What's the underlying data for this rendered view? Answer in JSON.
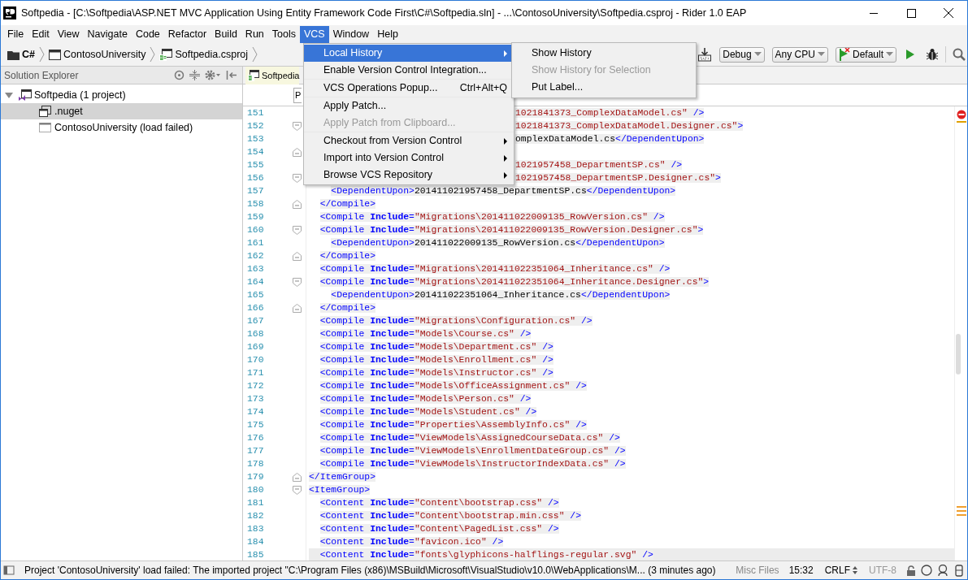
{
  "window": {
    "title": "Softpedia - [C:\\Softpedia\\ASP.NET MVC Application Using Entity Framework Code First\\C#\\Softpedia.sln] - ...\\ContosoUniversity\\Softpedia.csproj - Rider 1.0 EAP"
  },
  "menubar": [
    {
      "label": "File",
      "selected": false
    },
    {
      "label": "Edit",
      "selected": false
    },
    {
      "label": "View",
      "selected": false
    },
    {
      "label": "Navigate",
      "selected": false
    },
    {
      "label": "Code",
      "selected": false
    },
    {
      "label": "Refactor",
      "selected": false
    },
    {
      "label": "Build",
      "selected": false
    },
    {
      "label": "Run",
      "selected": false
    },
    {
      "label": "Tools",
      "selected": false
    },
    {
      "label": "VCS",
      "selected": true
    },
    {
      "label": "Window",
      "selected": false
    },
    {
      "label": "Help",
      "selected": false
    }
  ],
  "breadcrumbs": [
    {
      "label": "C#",
      "kind": "folder"
    },
    {
      "label": "ContosoUniversity",
      "kind": "project"
    },
    {
      "label": "Softpedia.csproj",
      "kind": "csproj"
    }
  ],
  "toolbar": {
    "configurations": [
      "Debug",
      "Any CPU",
      "Default"
    ]
  },
  "solution_explorer": {
    "title": "Solution Explorer",
    "tree": [
      {
        "label": "Softpedia (1 project)",
        "kind": "solution",
        "expanded": true,
        "selected": false,
        "children": [
          {
            "label": ".nuget",
            "kind": "folder",
            "selected": true
          },
          {
            "label": "ContosoUniversity (load failed)",
            "kind": "failed",
            "selected": false
          }
        ]
      }
    ]
  },
  "editor": {
    "tab": "Softpedia",
    "structure_field": "P",
    "lines": [
      {
        "number": "151",
        "covered": true,
        "starts_in_string": true,
        "text": "1021841373_ComplexDataModel.cs\" />"
      },
      {
        "number": "152",
        "covered": true,
        "starts_in_string": true,
        "text": "1021841373_ComplexDataModel.Designer.cs\">",
        "fold_open": true
      },
      {
        "number": "153",
        "covered": true,
        "starts_in_string": false,
        "text": "omplexDataModel.cs</DependentUpon>"
      },
      {
        "number": "154",
        "fold_open": false
      },
      {
        "number": "155",
        "covered": true,
        "starts_in_string": true,
        "text": "1021957458_DepartmentSP.cs\" />"
      },
      {
        "number": "156",
        "covered": true,
        "starts_in_string": true,
        "text": "1021957458_DepartmentSP.Designer.cs\">",
        "fold_open": true
      },
      {
        "number": "157",
        "text": "    <DependentUpon>201411021957458_DepartmentSP.cs</DependentUpon>"
      },
      {
        "number": "158",
        "text": "  </Compile>",
        "fold_open": false
      },
      {
        "number": "159",
        "text": "  <Compile Include=\"Migrations\\201411022009135_RowVersion.cs\" />"
      },
      {
        "number": "160",
        "text": "  <Compile Include=\"Migrations\\201411022009135_RowVersion.Designer.cs\">",
        "fold_open": true
      },
      {
        "number": "161",
        "text": "    <DependentUpon>201411022009135_RowVersion.cs</DependentUpon>"
      },
      {
        "number": "162",
        "text": "  </Compile>",
        "fold_open": false
      },
      {
        "number": "163",
        "text": "  <Compile Include=\"Migrations\\201411022351064_Inheritance.cs\" />"
      },
      {
        "number": "164",
        "text": "  <Compile Include=\"Migrations\\201411022351064_Inheritance.Designer.cs\">",
        "fold_open": true
      },
      {
        "number": "165",
        "text": "    <DependentUpon>201411022351064_Inheritance.cs</DependentUpon>"
      },
      {
        "number": "166",
        "text": "  </Compile>",
        "fold_open": false
      },
      {
        "number": "167",
        "text": "  <Compile Include=\"Migrations\\Configuration.cs\" />"
      },
      {
        "number": "168",
        "text": "  <Compile Include=\"Models\\Course.cs\" />"
      },
      {
        "number": "169",
        "text": "  <Compile Include=\"Models\\Department.cs\" />"
      },
      {
        "number": "170",
        "text": "  <Compile Include=\"Models\\Enrollment.cs\" />"
      },
      {
        "number": "171",
        "text": "  <Compile Include=\"Models\\Instructor.cs\" />"
      },
      {
        "number": "172",
        "text": "  <Compile Include=\"Models\\OfficeAssignment.cs\" />"
      },
      {
        "number": "173",
        "text": "  <Compile Include=\"Models\\Person.cs\" />"
      },
      {
        "number": "174",
        "text": "  <Compile Include=\"Models\\Student.cs\" />"
      },
      {
        "number": "175",
        "text": "  <Compile Include=\"Properties\\AssemblyInfo.cs\" />"
      },
      {
        "number": "176",
        "text": "  <Compile Include=\"ViewModels\\AssignedCourseData.cs\" />"
      },
      {
        "number": "177",
        "text": "  <Compile Include=\"ViewModels\\EnrollmentDateGroup.cs\" />"
      },
      {
        "number": "178",
        "text": "  <Compile Include=\"ViewModels\\InstructorIndexData.cs\" />"
      },
      {
        "number": "179",
        "text": "</ItemGroup>",
        "fold_open": false
      },
      {
        "number": "180",
        "text": "<ItemGroup>",
        "fold_open": true
      },
      {
        "number": "181",
        "text": "  <Content Include=\"Content\\bootstrap.css\" />"
      },
      {
        "number": "182",
        "text": "  <Content Include=\"Content\\bootstrap.min.css\" />"
      },
      {
        "number": "183",
        "text": "  <Content Include=\"Content\\PagedList.css\" />"
      },
      {
        "number": "184",
        "text": "  <Content Include=\"favicon.ico\" />"
      },
      {
        "number": "185",
        "text": "  <Content Include=\"fonts\\glyphicons-halflings-regular.svg\" />",
        "current": true
      }
    ]
  },
  "vcs_menu": [
    {
      "kind": "item",
      "label": "Local History",
      "submenu": true,
      "selected": true,
      "disabled": false
    },
    {
      "kind": "item",
      "label": "Enable Version Control Integration...",
      "selected": false,
      "disabled": false
    },
    {
      "kind": "separator"
    },
    {
      "kind": "item",
      "label": "VCS Operations Popup...",
      "shortcut": "Ctrl+Alt+Q",
      "selected": false,
      "disabled": false
    },
    {
      "kind": "separator"
    },
    {
      "kind": "item",
      "label": "Apply Patch...",
      "selected": false,
      "disabled": false
    },
    {
      "kind": "item",
      "label": "Apply Patch from Clipboard...",
      "selected": false,
      "disabled": true
    },
    {
      "kind": "separator"
    },
    {
      "kind": "item",
      "label": "Checkout from Version Control",
      "submenu": true,
      "selected": false,
      "disabled": false
    },
    {
      "kind": "item",
      "label": "Import into Version Control",
      "submenu": true,
      "selected": false,
      "disabled": false
    },
    {
      "kind": "item",
      "label": "Browse VCS Repository",
      "submenu": true,
      "selected": false,
      "disabled": false
    }
  ],
  "local_history_menu": [
    {
      "label": "Show History",
      "disabled": false
    },
    {
      "label": "Show History for Selection",
      "disabled": true
    },
    {
      "label": "Put Label...",
      "disabled": false
    }
  ],
  "status_bar": {
    "message": "Project 'ContosoUniversity' load failed: The imported project \"C:\\Program Files (x86)\\MSBuild\\Microsoft\\VisualStudio\\v10.0\\WebApplications\\M... (3 minutes ago)",
    "context": "Misc Files",
    "position": "15:32",
    "line_separator": "CRLF",
    "encoding": "UTF-8"
  }
}
